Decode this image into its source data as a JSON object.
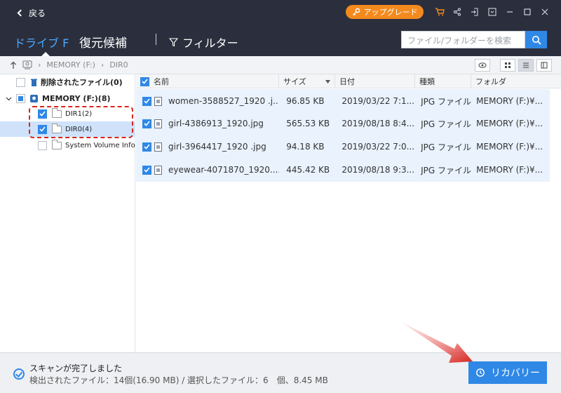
{
  "header": {
    "back_label": "戻る",
    "upgrade_label": "アップグレード",
    "window_icons": [
      "cart-icon",
      "share-icon",
      "signin-icon",
      "dropdown-icon",
      "minimize-icon",
      "maximize-icon",
      "close-icon"
    ],
    "tab_drive": "ドライブ F",
    "tab_recovery": "復元候補",
    "filter_label": "フィルター",
    "search_placeholder": "ファイル/フォルダーを検索"
  },
  "breadcrumb": {
    "items": [
      "MEMORY (F:)",
      "DIR0"
    ]
  },
  "tree": {
    "deleted_label": "削除されたファイル(0)",
    "drive_label": "MEMORY (F:)(8)",
    "folders": [
      {
        "label": "DIR1(2)",
        "checked": true
      },
      {
        "label": "DIR0(4)",
        "checked": true
      },
      {
        "label": "System Volume Informat",
        "checked": false
      }
    ]
  },
  "table": {
    "columns": [
      "名前",
      "サイズ",
      "日付",
      "種類",
      "フォルダ"
    ],
    "rows": [
      {
        "name": "women-3588527_1920 .j...",
        "size": "96.85 KB",
        "date": "2019/03/22 7:1...",
        "type": "JPG ファイル",
        "folder": "MEMORY (F:)¥..."
      },
      {
        "name": "girl-4386913_1920.jpg",
        "size": "565.53 KB",
        "date": "2019/08/18 8:4...",
        "type": "JPG ファイル",
        "folder": "MEMORY (F:)¥..."
      },
      {
        "name": "girl-3964417_1920 .jpg",
        "size": "94.18 KB",
        "date": "2019/03/22 7:0...",
        "type": "JPG ファイル",
        "folder": "MEMORY (F:)¥..."
      },
      {
        "name": "eyewear-4071870_1920....",
        "size": "445.42 KB",
        "date": "2019/08/18 9:3...",
        "type": "JPG ファイル",
        "folder": "MEMORY (F:)¥..."
      }
    ]
  },
  "footer": {
    "status_title": "スキャンが完了しました",
    "status_detail": "検出されたファイル：14個(16.90 MB) / 選択したファイル：6　個、8.45 MB",
    "recover_label": "リカバリー"
  },
  "colors": {
    "header_bg": "#2b2f3d",
    "accent": "#2f88e6",
    "upgrade": "#f48a1d",
    "highlight": "#d8261e"
  }
}
